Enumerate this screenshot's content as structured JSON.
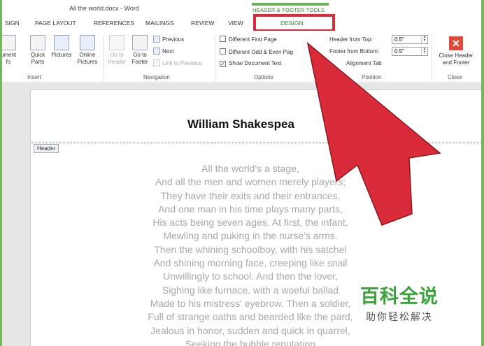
{
  "window": {
    "title": "All the world.docx - Word"
  },
  "contextual_tab_group": "HEADER & FOOTER TOOLS",
  "tabs": [
    "SIGN",
    "PAGE LAYOUT",
    "REFERENCES",
    "MAILINGS",
    "REVIEW",
    "VIEW",
    "DESIGN"
  ],
  "ribbon": {
    "insert": {
      "document_info": "ument\nfo",
      "quick_parts": "Quick\nParts",
      "pictures": "Pictures",
      "online_pictures": "Online\nPictures",
      "group_label": "Insert"
    },
    "navigation": {
      "go_to_header": "Go to\nHeader",
      "go_to_footer": "Go to\nFooter",
      "previous": "Previous",
      "next": "Next",
      "link_to_previous": "Link to Previous",
      "group_label": "Navigation"
    },
    "options": {
      "different_first_page": "Different First Page",
      "different_odd_even": "Different Odd & Even Pag",
      "show_document_text": "Show Document Text",
      "show_document_text_checked": true,
      "group_label": "Options"
    },
    "position": {
      "header_from_top_label": "Header from Top:",
      "header_from_top_value": "0.5\"",
      "footer_from_bottom_label": "Footer from Bottom:",
      "footer_from_bottom_value": "0.5\"",
      "alignment_tab": "Alignment Tab",
      "group_label": "Position"
    },
    "close": {
      "close_label": "Close Header\nand Footer",
      "group_label": "Close"
    }
  },
  "document": {
    "heading": "William Shakespea",
    "header_tag": "Header",
    "poem_lines": [
      "All the world's a stage,",
      "And all the men and women merely players;",
      "They have their exits and their entrances,",
      "And one man in his time plays many parts,",
      "His acts being seven ages. At first, the infant,",
      "Mewling and puking in the nurse's arms.",
      "Then the whining schoolboy, with his satchel",
      "And shining morning face, creeping like snail",
      "Unwillingly to school. And then the lover,",
      "Sighing like furnace, with a woeful ballad",
      "Made to his mistress' eyebrow. Then a soldier,",
      "Full of strange oaths and bearded like the pard,",
      "Jealous in honor, sudden and quick in quarrel,",
      "Seeking the bubble reputation"
    ]
  },
  "watermark": {
    "title": "百科全说",
    "subtitle": "助你轻松解决"
  },
  "colors": {
    "accent_green": "#6db35a",
    "highlight_red": "#d92b3a",
    "arrow_red": "#d92b3a"
  }
}
